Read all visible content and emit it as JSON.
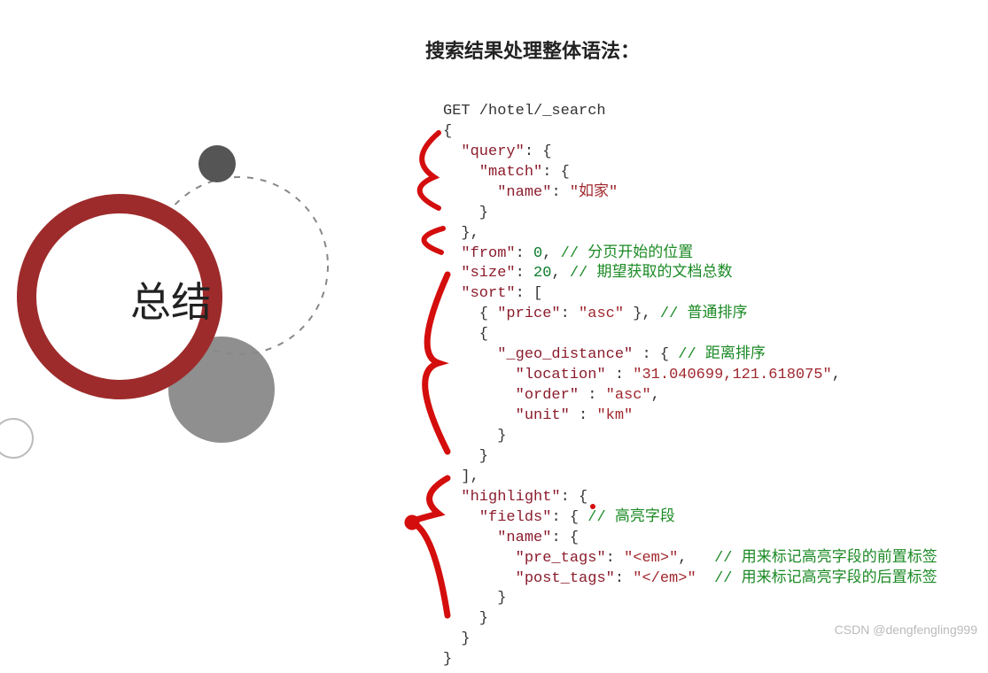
{
  "title": "搜索结果处理整体语法：",
  "summary_label": "总结",
  "code": {
    "request_line": "GET /hotel/_search",
    "query_key": "\"query\"",
    "match_key": "\"match\"",
    "name_key": "\"name\"",
    "name_value": "\"如家\"",
    "from_key": "\"from\"",
    "from_value": "0",
    "from_comment": "// 分页开始的位置",
    "size_key": "\"size\"",
    "size_value": "20",
    "size_comment": "// 期望获取的文档总数",
    "sort_key": "\"sort\"",
    "price_key": "\"price\"",
    "asc_value": "\"asc\"",
    "sort_plain_comment": "// 普通排序",
    "geo_key": "\"_geo_distance\"",
    "geo_comment": "// 距离排序",
    "location_key": "\"location\"",
    "location_value": "\"31.040699,121.618075\"",
    "order_key": "\"order\"",
    "unit_key": "\"unit\"",
    "unit_value": "\"km\"",
    "highlight_key": "\"highlight\"",
    "fields_key": "\"fields\"",
    "highlight_fields_comment": "// 高亮字段",
    "highlight_name_key": "\"name\"",
    "pre_tags_key": "\"pre_tags\"",
    "pre_tags_value": "\"<em>\"",
    "pre_tags_comment": "// 用来标记高亮字段的前置标签",
    "post_tags_key": "\"post_tags\"",
    "post_tags_value": "\"</em>\"",
    "post_tags_comment": "// 用来标记高亮字段的后置标签"
  },
  "watermark": "CSDN @dengfengling999"
}
